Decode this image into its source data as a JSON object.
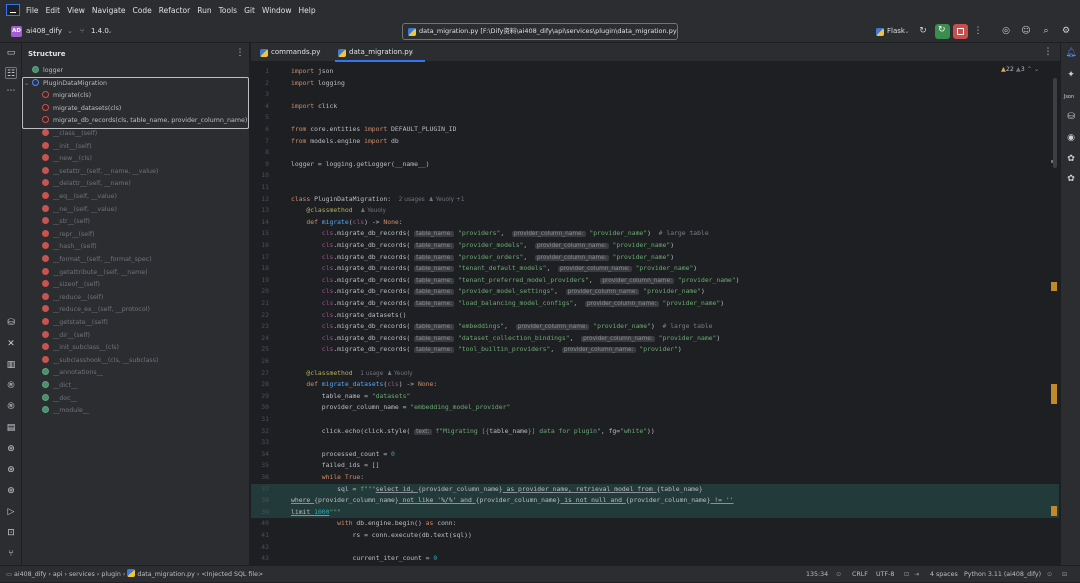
{
  "menu": {
    "items": [
      "File",
      "Edit",
      "View",
      "Navigate",
      "Code",
      "Refactor",
      "Run",
      "Tools",
      "Git",
      "Window",
      "Help"
    ]
  },
  "toolbar": {
    "project_initials": "AD",
    "project_name": "ai408_dify",
    "branch": "1.4.0",
    "file_selector": "data_migration.py [F:\\Dify资料\\ai408_dify\\api\\services\\plugin\\data_migration.py]",
    "run_config": "Flask",
    "accent_run": "#3b8d4c",
    "accent_stop": "#c94f4f"
  },
  "structure": {
    "title": "Structure",
    "items": [
      {
        "label": "logger",
        "kind": "field",
        "dim": false
      },
      {
        "label": "PluginDataMigration",
        "kind": "class",
        "dim": false
      },
      {
        "label": "migrate(cls)",
        "kind": "method",
        "dim": false
      },
      {
        "label": "migrate_datasets(cls)",
        "kind": "method",
        "dim": false
      },
      {
        "label": "migrate_db_records(cls, table_name, provider_column_name)",
        "kind": "method",
        "dim": false
      },
      {
        "label": "__class__(self)",
        "kind": "method",
        "dim": true
      },
      {
        "label": "__init__(self)",
        "kind": "method",
        "dim": true
      },
      {
        "label": "__new__(cls)",
        "kind": "method",
        "dim": true
      },
      {
        "label": "__setattr__(self, __name, __value)",
        "kind": "method",
        "dim": true
      },
      {
        "label": "__delattr__(self, __name)",
        "kind": "method",
        "dim": true
      },
      {
        "label": "__eq__(self, __value)",
        "kind": "method",
        "dim": true
      },
      {
        "label": "__ne__(self, __value)",
        "kind": "method",
        "dim": true
      },
      {
        "label": "__str__(self)",
        "kind": "method",
        "dim": true
      },
      {
        "label": "__repr__(self)",
        "kind": "method",
        "dim": true
      },
      {
        "label": "__hash__(self)",
        "kind": "method",
        "dim": true
      },
      {
        "label": "__format__(self, __format_spec)",
        "kind": "method",
        "dim": true
      },
      {
        "label": "__getattribute__(self, __name)",
        "kind": "method",
        "dim": true
      },
      {
        "label": "__sizeof__(self)",
        "kind": "method",
        "dim": true
      },
      {
        "label": "__reduce__(self)",
        "kind": "method",
        "dim": true
      },
      {
        "label": "__reduce_ex__(self, __protocol)",
        "kind": "method",
        "dim": true
      },
      {
        "label": "__getstate__(self)",
        "kind": "method",
        "dim": true
      },
      {
        "label": "__dir__(self)",
        "kind": "method",
        "dim": true
      },
      {
        "label": "__init_subclass__(cls)",
        "kind": "method",
        "dim": true
      },
      {
        "label": "__subclasshook__(cls, __subclass)",
        "kind": "method",
        "dim": true
      },
      {
        "label": "__annotations__",
        "kind": "field",
        "dim": true
      },
      {
        "label": "__dict__",
        "kind": "field",
        "dim": true
      },
      {
        "label": "__doc__",
        "kind": "field",
        "dim": true
      },
      {
        "label": "__module__",
        "kind": "field",
        "dim": true
      }
    ]
  },
  "tabs": [
    {
      "label": "commands.py",
      "active": false
    },
    {
      "label": "data_migration.py",
      "active": true
    }
  ],
  "inspections": {
    "warnings": "22",
    "weak": "3"
  },
  "code": [
    {
      "n": "1",
      "html": "<span class=kw>import</span> json"
    },
    {
      "n": "2",
      "html": "<span class=kw>import</span> logging"
    },
    {
      "n": "3",
      "html": ""
    },
    {
      "n": "4",
      "html": "<span class=kw>import</span> click"
    },
    {
      "n": "5",
      "html": ""
    },
    {
      "n": "6",
      "html": "<span class=kw>from</span> core.entities <span class=kw>import</span> DEFAULT_PLUGIN_ID"
    },
    {
      "n": "7",
      "html": "<span class=kw>from</span> models.engine <span class=kw>import</span> db"
    },
    {
      "n": "8",
      "html": ""
    },
    {
      "n": "9",
      "html": "logger = logging.getLogger(__name__)"
    },
    {
      "n": "10",
      "html": ""
    },
    {
      "n": "11",
      "html": ""
    },
    {
      "n": "12",
      "html": "<span class=kw>class</span> PluginDataMigration:  <span class=meta>2 usages  &#9823; Yeuoly +1</span>"
    },
    {
      "n": "13",
      "html": "    <span class=dec>@classmethod</span>  <span class=meta>&#9823; Yeuoly</span>"
    },
    {
      "n": "14",
      "html": "    <span class=kw>def</span> <span class=fn>migrate</span>(<span class=self>cls</span>) -> <span class=kw>None</span>:"
    },
    {
      "n": "15",
      "html": "        <span class=self>cls</span>.migrate_db_records( <span class=hint>table_name:</span> <span class=str>\"providers\"</span>,  <span class=hint>provider_column_name:</span> <span class=str>\"provider_name\"</span>)  <span class=cm># large table</span>"
    },
    {
      "n": "16",
      "html": "        <span class=self>cls</span>.migrate_db_records( <span class=hint>table_name:</span> <span class=str>\"provider_models\"</span>,  <span class=hint>provider_column_name:</span> <span class=str>\"provider_name\"</span>)"
    },
    {
      "n": "17",
      "html": "        <span class=self>cls</span>.migrate_db_records( <span class=hint>table_name:</span> <span class=str>\"provider_orders\"</span>,  <span class=hint>provider_column_name:</span> <span class=str>\"provider_name\"</span>)"
    },
    {
      "n": "18",
      "html": "        <span class=self>cls</span>.migrate_db_records( <span class=hint>table_name:</span> <span class=str>\"tenant_default_models\"</span>,  <span class=hint>provider_column_name:</span> <span class=str>\"provider_name\"</span>)"
    },
    {
      "n": "19",
      "html": "        <span class=self>cls</span>.migrate_db_records( <span class=hint>table_name:</span> <span class=str>\"tenant_preferred_model_providers\"</span>,  <span class=hint>provider_column_name:</span> <span class=str>\"provider_name\"</span>)"
    },
    {
      "n": "20",
      "html": "        <span class=self>cls</span>.migrate_db_records( <span class=hint>table_name:</span> <span class=str>\"provider_model_settings\"</span>,  <span class=hint>provider_column_name:</span> <span class=str>\"provider_name\"</span>)"
    },
    {
      "n": "21",
      "html": "        <span class=self>cls</span>.migrate_db_records( <span class=hint>table_name:</span> <span class=str>\"load_balancing_model_configs\"</span>,  <span class=hint>provider_column_name:</span> <span class=str>\"provider_name\"</span>)"
    },
    {
      "n": "22",
      "html": "        <span class=self>cls</span>.migrate_datasets()"
    },
    {
      "n": "23",
      "html": "        <span class=self>cls</span>.migrate_db_records( <span class=hint>table_name:</span> <span class=str>\"embeddings\"</span>,  <span class=hint>provider_column_name:</span> <span class=str>\"provider_name\"</span>)  <span class=cm># large table</span>"
    },
    {
      "n": "24",
      "html": "        <span class=self>cls</span>.migrate_db_records( <span class=hint>table_name:</span> <span class=str>\"dataset_collection_bindings\"</span>,  <span class=hint>provider_column_name:</span> <span class=str>\"provider_name\"</span>)"
    },
    {
      "n": "25",
      "html": "        <span class=self>cls</span>.migrate_db_records( <span class=hint>table_name:</span> <span class=str>\"tool_builtin_providers\"</span>,  <span class=hint>provider_column_name:</span> <span class=str>\"provider\"</span>)"
    },
    {
      "n": "26",
      "html": ""
    },
    {
      "n": "27",
      "html": "    <span class=dec>@classmethod</span>  <span class=meta>1 usage  &#9823; Yeuoly</span>"
    },
    {
      "n": "28",
      "html": "    <span class=kw>def</span> <span class=fn>migrate_datasets</span>(<span class=self>cls</span>) -> <span class=kw>None</span>:"
    },
    {
      "n": "29",
      "html": "        table_name = <span class=str>\"datasets\"</span>"
    },
    {
      "n": "30",
      "html": "        provider_column_name = <span class=str>\"embedding_model_provider\"</span>"
    },
    {
      "n": "31",
      "html": ""
    },
    {
      "n": "32",
      "html": "        click.echo(click.style( <span class=hint>text:</span> <span class=str>f\"Migrating [{</span>table_name<span class=str>}] data for plugin\"</span>, fg=<span class=str>\"white\"</span>))"
    },
    {
      "n": "33",
      "html": ""
    },
    {
      "n": "34",
      "html": "        processed_count = <span class=num>0</span>"
    },
    {
      "n": "35",
      "html": "        failed_ids = []"
    },
    {
      "n": "36",
      "html": "        <span class=kw>while</span> <span class=kw>True</span>:"
    },
    {
      "n": "37",
      "html": "            sql = <span class=str>f\"\"\"</span><span class=ul>select id, </span>{provider_column_name}<span class=ul> as provider_name, retrieval_model from </span>{table_name}"
    },
    {
      "n": "38",
      "html": "<span class=ul>where </span>{provider_column_name}<span class=ul> not like '%/%' and </span>{provider_column_name}<span class=ul> is not null and </span>{provider_column_name}<span class=ul> != ''</span>"
    },
    {
      "n": "39",
      "html": "<span class=ul>limit <span class=num>1000</span></span><span class=str>\"\"\"</span>"
    },
    {
      "n": "40",
      "html": "            <span class=kw>with</span> db.engine.begin() <span class=kw>as</span> conn:"
    },
    {
      "n": "41",
      "html": "                rs = conn.execute(db.text(sql))"
    },
    {
      "n": "42",
      "html": ""
    },
    {
      "n": "43",
      "html": "                current_iter_count = <span class=num>0</span>"
    }
  ],
  "status": {
    "breadcrumb": [
      "ai408_dify",
      "api",
      "services",
      "plugin",
      "data_migration.py",
      "<Injected SQL file>"
    ],
    "position": "135:34",
    "line_sep": "CRLF",
    "encoding": "UTF-8",
    "indent": "4 spaces",
    "interpreter": "Python 3.11 (ai408_dify)"
  }
}
